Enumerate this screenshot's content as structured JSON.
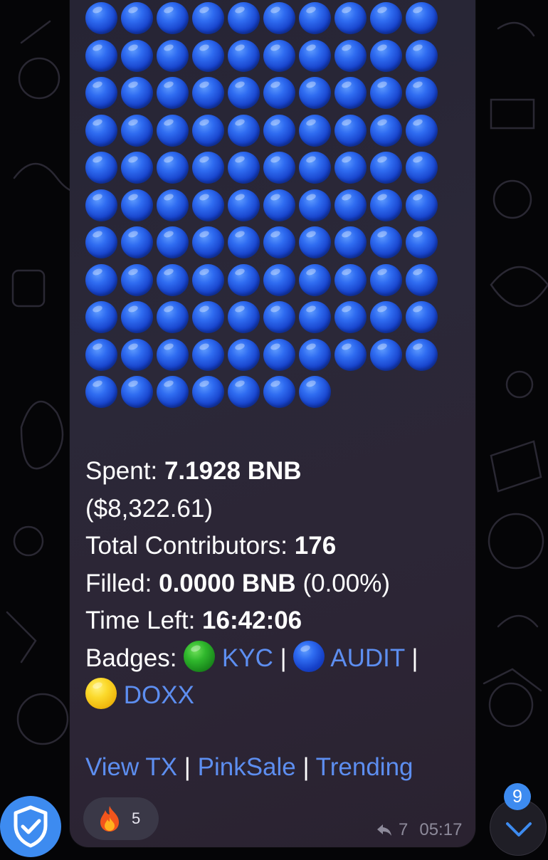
{
  "message": {
    "dot_grid": {
      "full_rows": 10,
      "per_row": 10,
      "last_row_count": 7,
      "color": "#2f6cf1"
    },
    "lines": {
      "spent_label": "Spent:",
      "spent_value": "7.1928 BNB",
      "spent_usd": "($8,322.61)",
      "contributors_label": "Total Contributors:",
      "contributors_value": "176",
      "filled_label": "Filled:",
      "filled_value": "0.0000 BNB",
      "filled_percent": "(0.00%)",
      "time_label": "Time Left:",
      "time_value": "16:42:06",
      "badges_label": "Badges:",
      "badge_kyc": "KYC",
      "badge_audit": "AUDIT",
      "badge_doxx": "DOXX",
      "separator": "|"
    },
    "links": {
      "view_tx": "View TX",
      "pinksale": "PinkSale",
      "trending": "Trending",
      "separator": "|"
    },
    "reaction": {
      "emoji_icon": "fire-icon",
      "count": "5"
    },
    "meta": {
      "forwards": "7",
      "time": "05:17"
    }
  },
  "scroll_down": {
    "unread_count": "9"
  },
  "colors": {
    "bubble": "#2a2737",
    "link": "#5d8ef0",
    "badge": "#3d8bf0",
    "shield": "#3d8bf0"
  }
}
